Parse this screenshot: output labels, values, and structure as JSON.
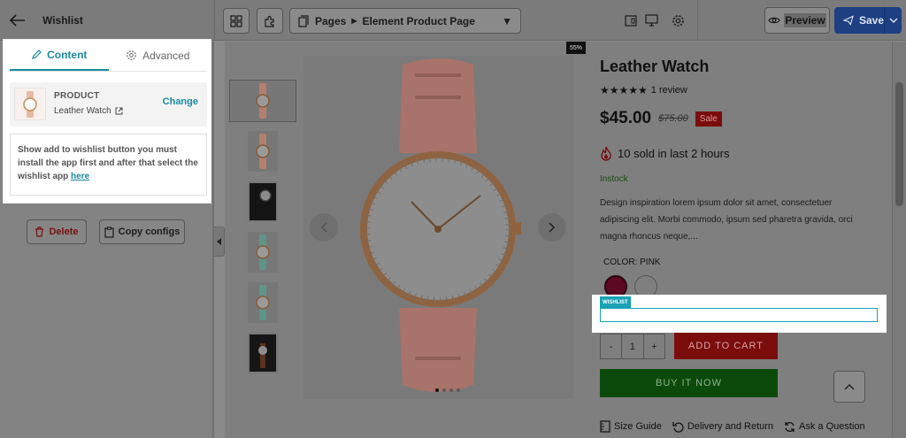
{
  "header": {
    "panel_title": "Wishlist",
    "breadcrumb": {
      "root": "Pages",
      "current": "Element Product Page"
    },
    "preview_label": "Preview",
    "save_label": "Save"
  },
  "sidebar": {
    "tabs": [
      {
        "label": "Content",
        "active": true
      },
      {
        "label": "Advanced",
        "active": false
      }
    ],
    "product": {
      "kicker": "PRODUCT",
      "name": "Leather Watch",
      "change_label": "Change"
    },
    "info": {
      "text": "Show add to wishlist button you must install the app first and after that select the wishlist app ",
      "link_label": "here"
    },
    "delete_label": "Delete",
    "copy_label": "Copy configs"
  },
  "canvas": {
    "zoom": "55%",
    "product": {
      "title": "Leather Watch",
      "rating_text": "1 review",
      "stars": 5,
      "price": "$45.00",
      "compare_price": "$75.00",
      "sale_label": "Sale",
      "sold_text": "10 sold in last 2 hours",
      "stock": "Instock",
      "description": "Design inspiration lorem ipsum dolor sit amet, consectetuer adipiscing elit. Morbi commodo, ipsum sed pharetra gravida, orci magna rhoncus neque,...",
      "color_label": "COLOR: PINK",
      "wishlist_tag": "WISHLIST",
      "qty_minus": "-",
      "qty_value": "1",
      "qty_plus": "+",
      "add_to_cart": "ADD TO CART",
      "buy_now": "BUY IT NOW",
      "links": [
        "Size Guide",
        "Delivery and Return",
        "Ask a Question"
      ]
    }
  },
  "colors": {
    "accent": "#1b8aa0",
    "save": "#1e3f82",
    "sale": "#7a0c0c",
    "buy": "#0c4a0c"
  }
}
